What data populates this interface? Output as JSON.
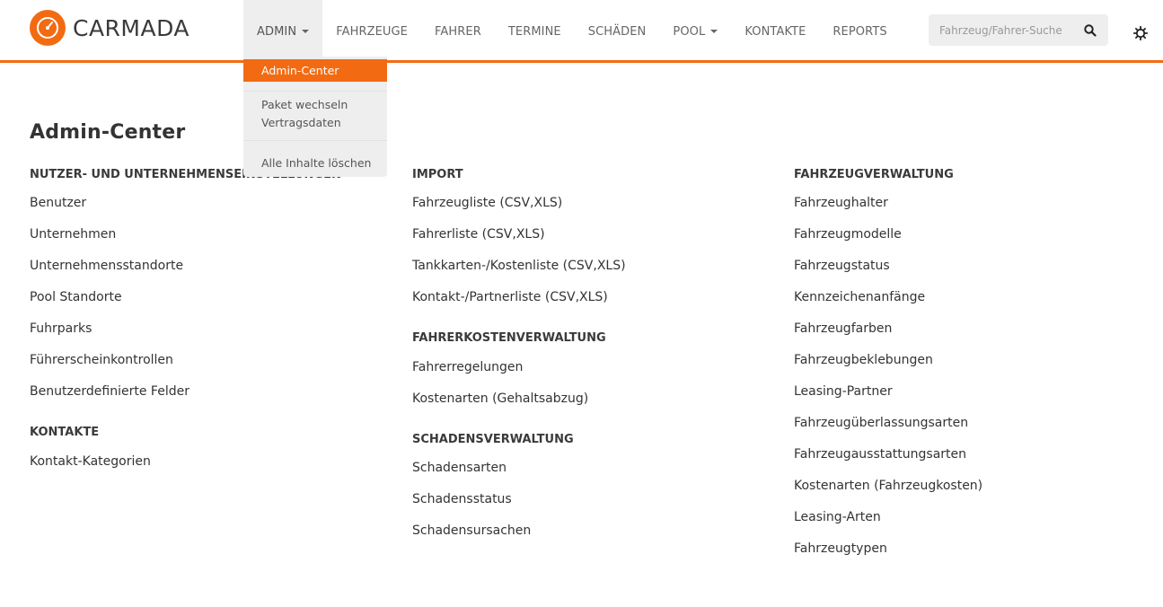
{
  "app": {
    "logo_text": "CARMADA"
  },
  "nav": {
    "items": [
      {
        "label": "ADMIN"
      },
      {
        "label": "FAHRZEUGE"
      },
      {
        "label": "FAHRER"
      },
      {
        "label": "TERMINE"
      },
      {
        "label": "SCHÄDEN"
      },
      {
        "label": "POOL"
      },
      {
        "label": "KONTAKTE"
      },
      {
        "label": "REPORTS"
      }
    ]
  },
  "search": {
    "placeholder": "Fahrzeug/Fahrer-Suche"
  },
  "admin_dropdown": {
    "items": [
      {
        "label": "Admin-Center"
      },
      {
        "label": "Paket wechseln"
      },
      {
        "label": "Vertragsdaten"
      },
      {
        "label": "Alle Inhalte löschen"
      }
    ]
  },
  "page": {
    "title": "Admin-Center"
  },
  "sections": {
    "nutzer": {
      "title": "NUTZER- UND UNTERNEHMENSEINSTELLUNGEN",
      "links": [
        "Benutzer",
        "Unternehmen",
        "Unternehmensstandorte",
        "Pool Standorte",
        "Fuhrparks",
        "Führerscheinkontrollen",
        "Benutzerdefinierte Felder"
      ]
    },
    "kontakte": {
      "title": "KONTAKTE",
      "links": [
        "Kontakt-Kategorien"
      ]
    },
    "import": {
      "title": "IMPORT",
      "links": [
        "Fahrzeugliste (CSV,XLS)",
        "Fahrerliste (CSV,XLS)",
        "Tankkarten-/Kostenliste (CSV,XLS)",
        "Kontakt-/Partnerliste (CSV,XLS)"
      ]
    },
    "fahrerkosten": {
      "title": "FAHRERKOSTENVERWALTUNG",
      "links": [
        "Fahrerregelungen",
        "Kostenarten (Gehaltsabzug)"
      ]
    },
    "schaden": {
      "title": "SCHADENSVERWALTUNG",
      "links": [
        "Schadensarten",
        "Schadensstatus",
        "Schadensursachen"
      ]
    },
    "fahrzeug": {
      "title": "FAHRZEUGVERWALTUNG",
      "links": [
        "Fahrzeughalter",
        "Fahrzeugmodelle",
        "Fahrzeugstatus",
        "Kennzeichenanfänge",
        "Fahrzeugfarben",
        "Fahrzeugbeklebungen",
        "Leasing-Partner",
        "Fahrzeugüberlassungsarten",
        "Fahrzeugausstattungsarten",
        "Kostenarten (Fahrzeugkosten)",
        "Leasing-Arten",
        "Fahrzeugtypen"
      ]
    }
  }
}
